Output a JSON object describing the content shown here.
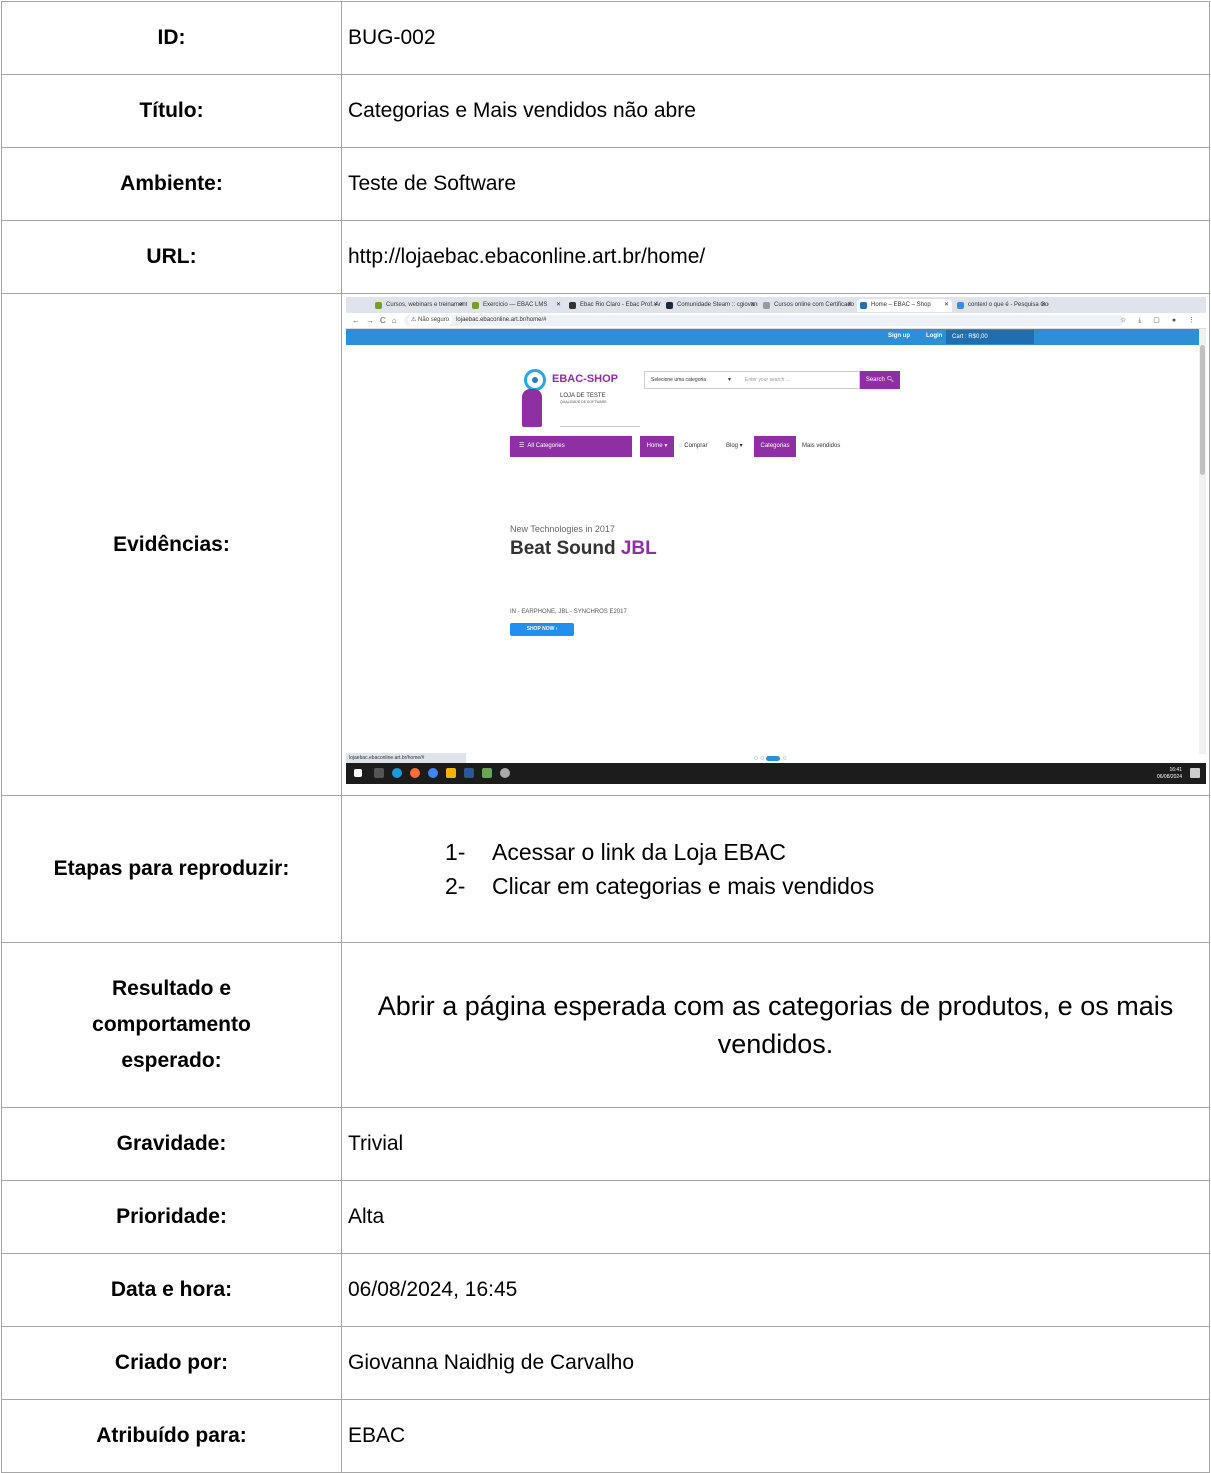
{
  "rows": {
    "id": {
      "label": "ID:",
      "value": "BUG-002"
    },
    "titulo": {
      "label": "Título:",
      "value": "Categorias e Mais vendidos não abre"
    },
    "ambiente": {
      "label": "Ambiente:",
      "value": "Teste de Software"
    },
    "url": {
      "label": "URL:",
      "value": "http://lojaebac.ebaconline.art.br/home/"
    },
    "evidencias": {
      "label": "Evidências:"
    },
    "etapas": {
      "label": "Etapas para reproduzir:",
      "steps": [
        {
          "num": "1-",
          "text": "Acessar o link da Loja EBAC"
        },
        {
          "num": "2-",
          "text": "Clicar em categorias e mais vendidos"
        }
      ]
    },
    "resultado": {
      "label": "Resultado e comportamento esperado:",
      "value": "Abrir a página esperada com as categorias de produtos, e os mais vendidos."
    },
    "gravidade": {
      "label": "Gravidade:",
      "value": "Trivial"
    },
    "prioridade": {
      "label": "Prioridade:",
      "value": "Alta"
    },
    "data": {
      "label": "Data e hora:",
      "value": "06/08/2024, 16:45"
    },
    "criado": {
      "label": "Criado por:",
      "value": "Giovanna Naidhig de Carvalho"
    },
    "atribuido": {
      "label": "Atribuído para:",
      "value": "EBAC"
    }
  },
  "screenshot": {
    "tabs": [
      {
        "title": "Cursos, webinars e treinamento",
        "color": "#7a9a3a"
      },
      {
        "title": "Exercício — EBAC LMS",
        "color": "#7a9a3a"
      },
      {
        "title": "Ebac Rio Claro - Ebac Prof. Arno",
        "color": "#333333"
      },
      {
        "title": "Comunidade Steam :: cgiovanni",
        "color": "#1b2838"
      },
      {
        "title": "Cursos online com Certificado",
        "color": "#999999"
      },
      {
        "title": "Home – EBAC – Shop",
        "color": "#2271b1"
      },
      {
        "title": "contexl o que é - Pesquisa Goo",
        "color": "#4285f4"
      }
    ],
    "address": {
      "security": "Não seguro",
      "url": "lojaebac.ebaconline.art.br/home/#"
    },
    "topbar": {
      "signup": "Sign up",
      "login": "Login",
      "cart": "Cart : R$0,00"
    },
    "logo": {
      "title": "EBAC-SHOP",
      "subtitle": "LOJA DE TESTE",
      "tagline": "QUALIDADE DE SOFTWARE"
    },
    "search": {
      "category": "Selecione uma categoria",
      "placeholder": "Enter your search ...",
      "button": "Search"
    },
    "menu": {
      "all_categories": "All Categories",
      "home": "Home",
      "comprar": "Comprar",
      "blog": "Blog",
      "categorias": "Categorias",
      "mais_vendidos": "Mais vendidos"
    },
    "hero": {
      "kicker": "New Technologies in 2017",
      "title": "Beat Sound",
      "highlight": "JBL",
      "info": "IN - EARPHONE, JBL - SYNCHROS E2017",
      "button": "SHOP NOW"
    },
    "status_url": "lojaebac.ebaconline.art.br/home/#",
    "clock": {
      "time": "16:41",
      "date": "06/08/2024"
    }
  }
}
